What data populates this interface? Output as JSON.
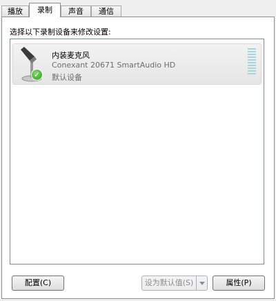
{
  "tabs": [
    {
      "label": "播放",
      "active": false
    },
    {
      "label": "录制",
      "active": true
    },
    {
      "label": "声音",
      "active": false
    },
    {
      "label": "通信",
      "active": false
    }
  ],
  "instruction": "选择以下录制设备来修改设置:",
  "device": {
    "name": "内装麦克风",
    "description": "Conexant 20671 SmartAudio HD",
    "status": "默认设备",
    "icon": "microphone-icon",
    "badge_icon": "default-check-icon"
  },
  "buttons": {
    "configure": "配置(C)",
    "set_default": "设为默认值(S)",
    "properties": "属性(P)"
  },
  "colors": {
    "panel_bg": "#ffffff",
    "window_bg": "#f0f0f0",
    "meter": "#a8d4dc",
    "check": "#2f9a1f"
  }
}
